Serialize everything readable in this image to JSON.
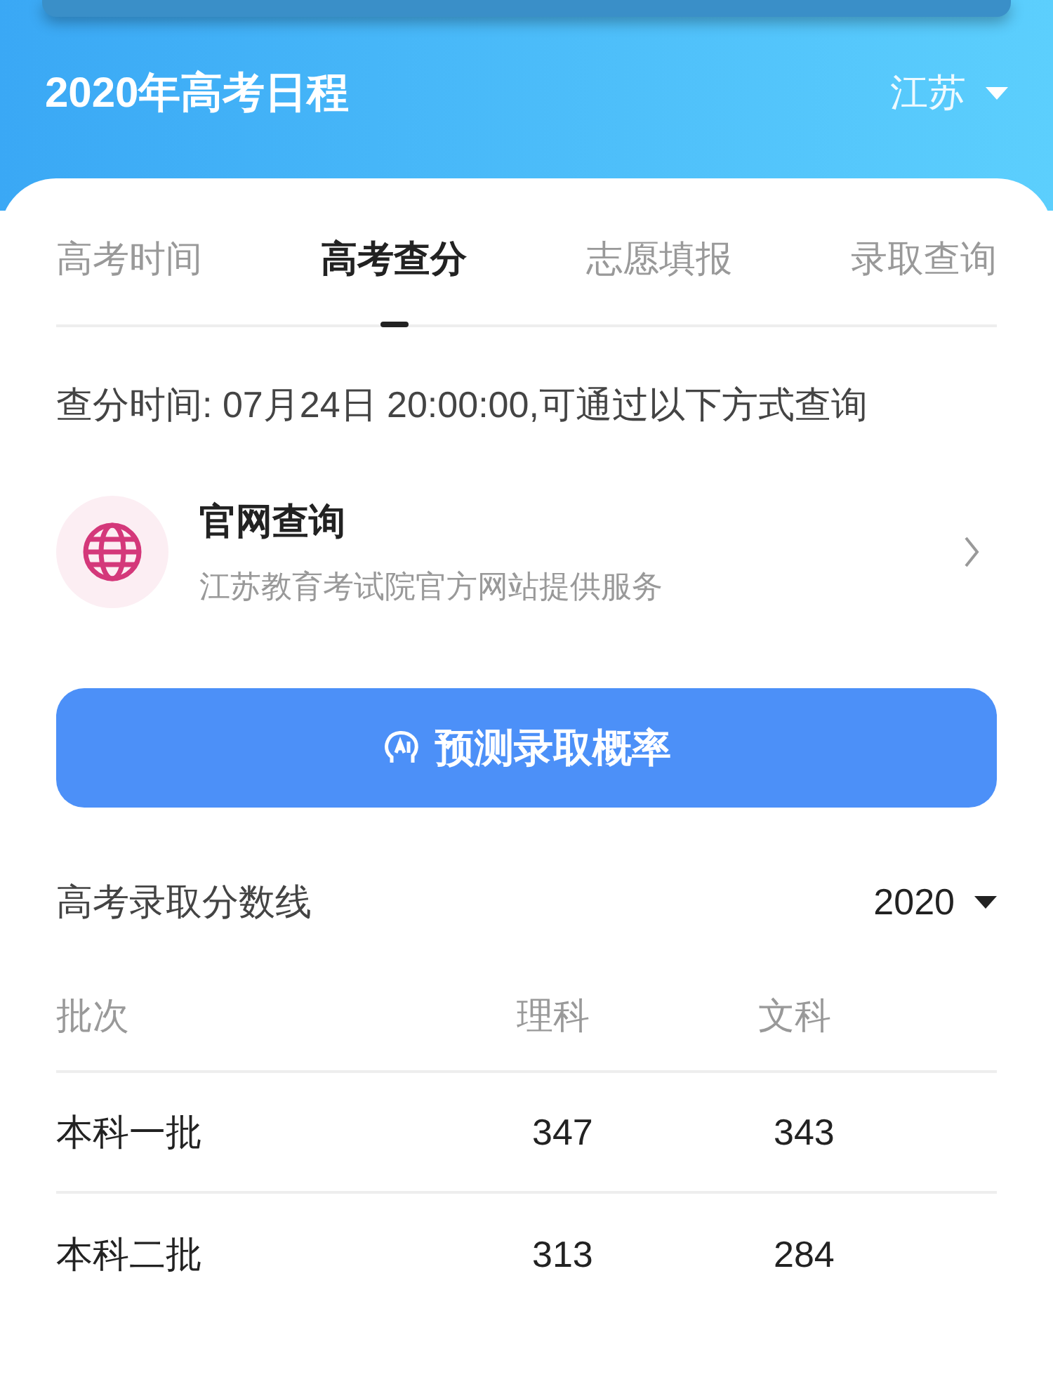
{
  "header": {
    "title": "2020年高考日程",
    "province": "江苏"
  },
  "tabs": [
    {
      "label": "高考时间",
      "selected": false
    },
    {
      "label": "高考查分",
      "selected": true
    },
    {
      "label": "志愿填报",
      "selected": false
    },
    {
      "label": "录取查询",
      "selected": false
    }
  ],
  "query_time": "查分时间: 07月24日 20:00:00,可通过以下方式查询",
  "official_site": {
    "title": "官网查询",
    "subtitle": "江苏教育考试院官方网站提供服务"
  },
  "predict_button": "预测录取概率",
  "score_lines": {
    "title": "高考录取分数线",
    "year": "2020",
    "columns": [
      "批次",
      "理科",
      "文科"
    ],
    "rows": [
      [
        "本科一批",
        "347",
        "343"
      ],
      [
        "本科二批",
        "313",
        "284"
      ]
    ]
  }
}
